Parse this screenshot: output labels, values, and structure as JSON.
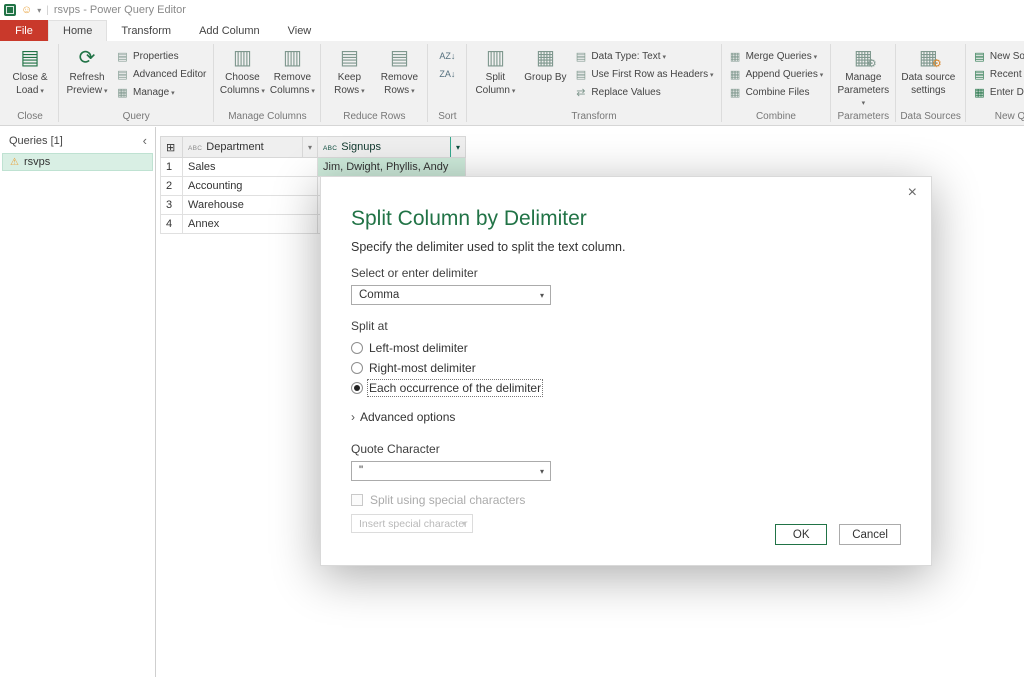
{
  "titlebar": {
    "title": "rsvps - Power Query Editor"
  },
  "tabs": {
    "file": "File",
    "home": "Home",
    "transform": "Transform",
    "add_column": "Add Column",
    "view": "View"
  },
  "ribbon": {
    "close_group": {
      "label": "Close",
      "close_load": "Close & Load"
    },
    "query_group": {
      "label": "Query",
      "refresh": "Refresh Preview",
      "properties": "Properties",
      "advanced_editor": "Advanced Editor",
      "manage": "Manage"
    },
    "manage_columns_group": {
      "label": "Manage Columns",
      "choose_columns": "Choose Columns",
      "remove_columns": "Remove Columns"
    },
    "reduce_rows_group": {
      "label": "Reduce Rows",
      "keep_rows": "Keep Rows",
      "remove_rows": "Remove Rows"
    },
    "sort_group": {
      "label": "Sort"
    },
    "transform_group": {
      "label": "Transform",
      "split_column": "Split Column",
      "group_by": "Group By",
      "data_type": "Data Type: Text",
      "first_row": "Use First Row as Headers",
      "replace_values": "Replace Values"
    },
    "combine_group": {
      "label": "Combine",
      "merge": "Merge Queries",
      "append": "Append Queries",
      "combine_files": "Combine Files"
    },
    "parameters_group": {
      "label": "Parameters",
      "manage_parameters": "Manage Parameters"
    },
    "data_sources_group": {
      "label": "Data Sources",
      "settings": "Data source settings"
    },
    "new_query_group": {
      "label": "New Query",
      "new_source": "New Source",
      "recent_sources": "Recent Sources",
      "enter_data": "Enter Data"
    }
  },
  "queries_pane": {
    "header": "Queries [1]",
    "item": "rsvps"
  },
  "grid": {
    "columns": {
      "department": {
        "type": "ABC",
        "name": "Department"
      },
      "signups": {
        "type": "ABC",
        "name": "Signups"
      }
    },
    "rows": [
      {
        "n": "1",
        "department": "Sales",
        "signups": "Jim, Dwight, Phyllis, Andy"
      },
      {
        "n": "2",
        "department": "Accounting",
        "signups": ""
      },
      {
        "n": "3",
        "department": "Warehouse",
        "signups": ""
      },
      {
        "n": "4",
        "department": "Annex",
        "signups": ""
      }
    ]
  },
  "dialog": {
    "title": "Split Column by Delimiter",
    "subtitle": "Specify the delimiter used to split the text column.",
    "delimiter_label": "Select or enter delimiter",
    "delimiter_value": "Comma",
    "split_at_label": "Split at",
    "option_left": "Left-most delimiter",
    "option_right": "Right-most delimiter",
    "option_each": "Each occurrence of the delimiter",
    "advanced_label": "Advanced options",
    "quote_label": "Quote Character",
    "quote_value": "\"",
    "special_checkbox": "Split using special characters",
    "special_dropdown": "Insert special character",
    "ok": "OK",
    "cancel": "Cancel"
  },
  "colors": {
    "accent_green": "#217346",
    "selection_teal": "#3eb79b",
    "selection_light": "#cdeada",
    "file_tab_red": "#c9392b"
  },
  "icons": {
    "table": "▦",
    "sheet": "▤",
    "columns": "▥",
    "refresh": "⟳",
    "gear": "⚙",
    "swap": "⇄",
    "warning": "⚠",
    "smiley": "☺",
    "chevron_down": "▾",
    "chevron_left": "‹",
    "chevron_right": "›",
    "close": "×",
    "corner": "⊞",
    "sort_az": "AZ↓",
    "sort_za": "ZA↓"
  }
}
